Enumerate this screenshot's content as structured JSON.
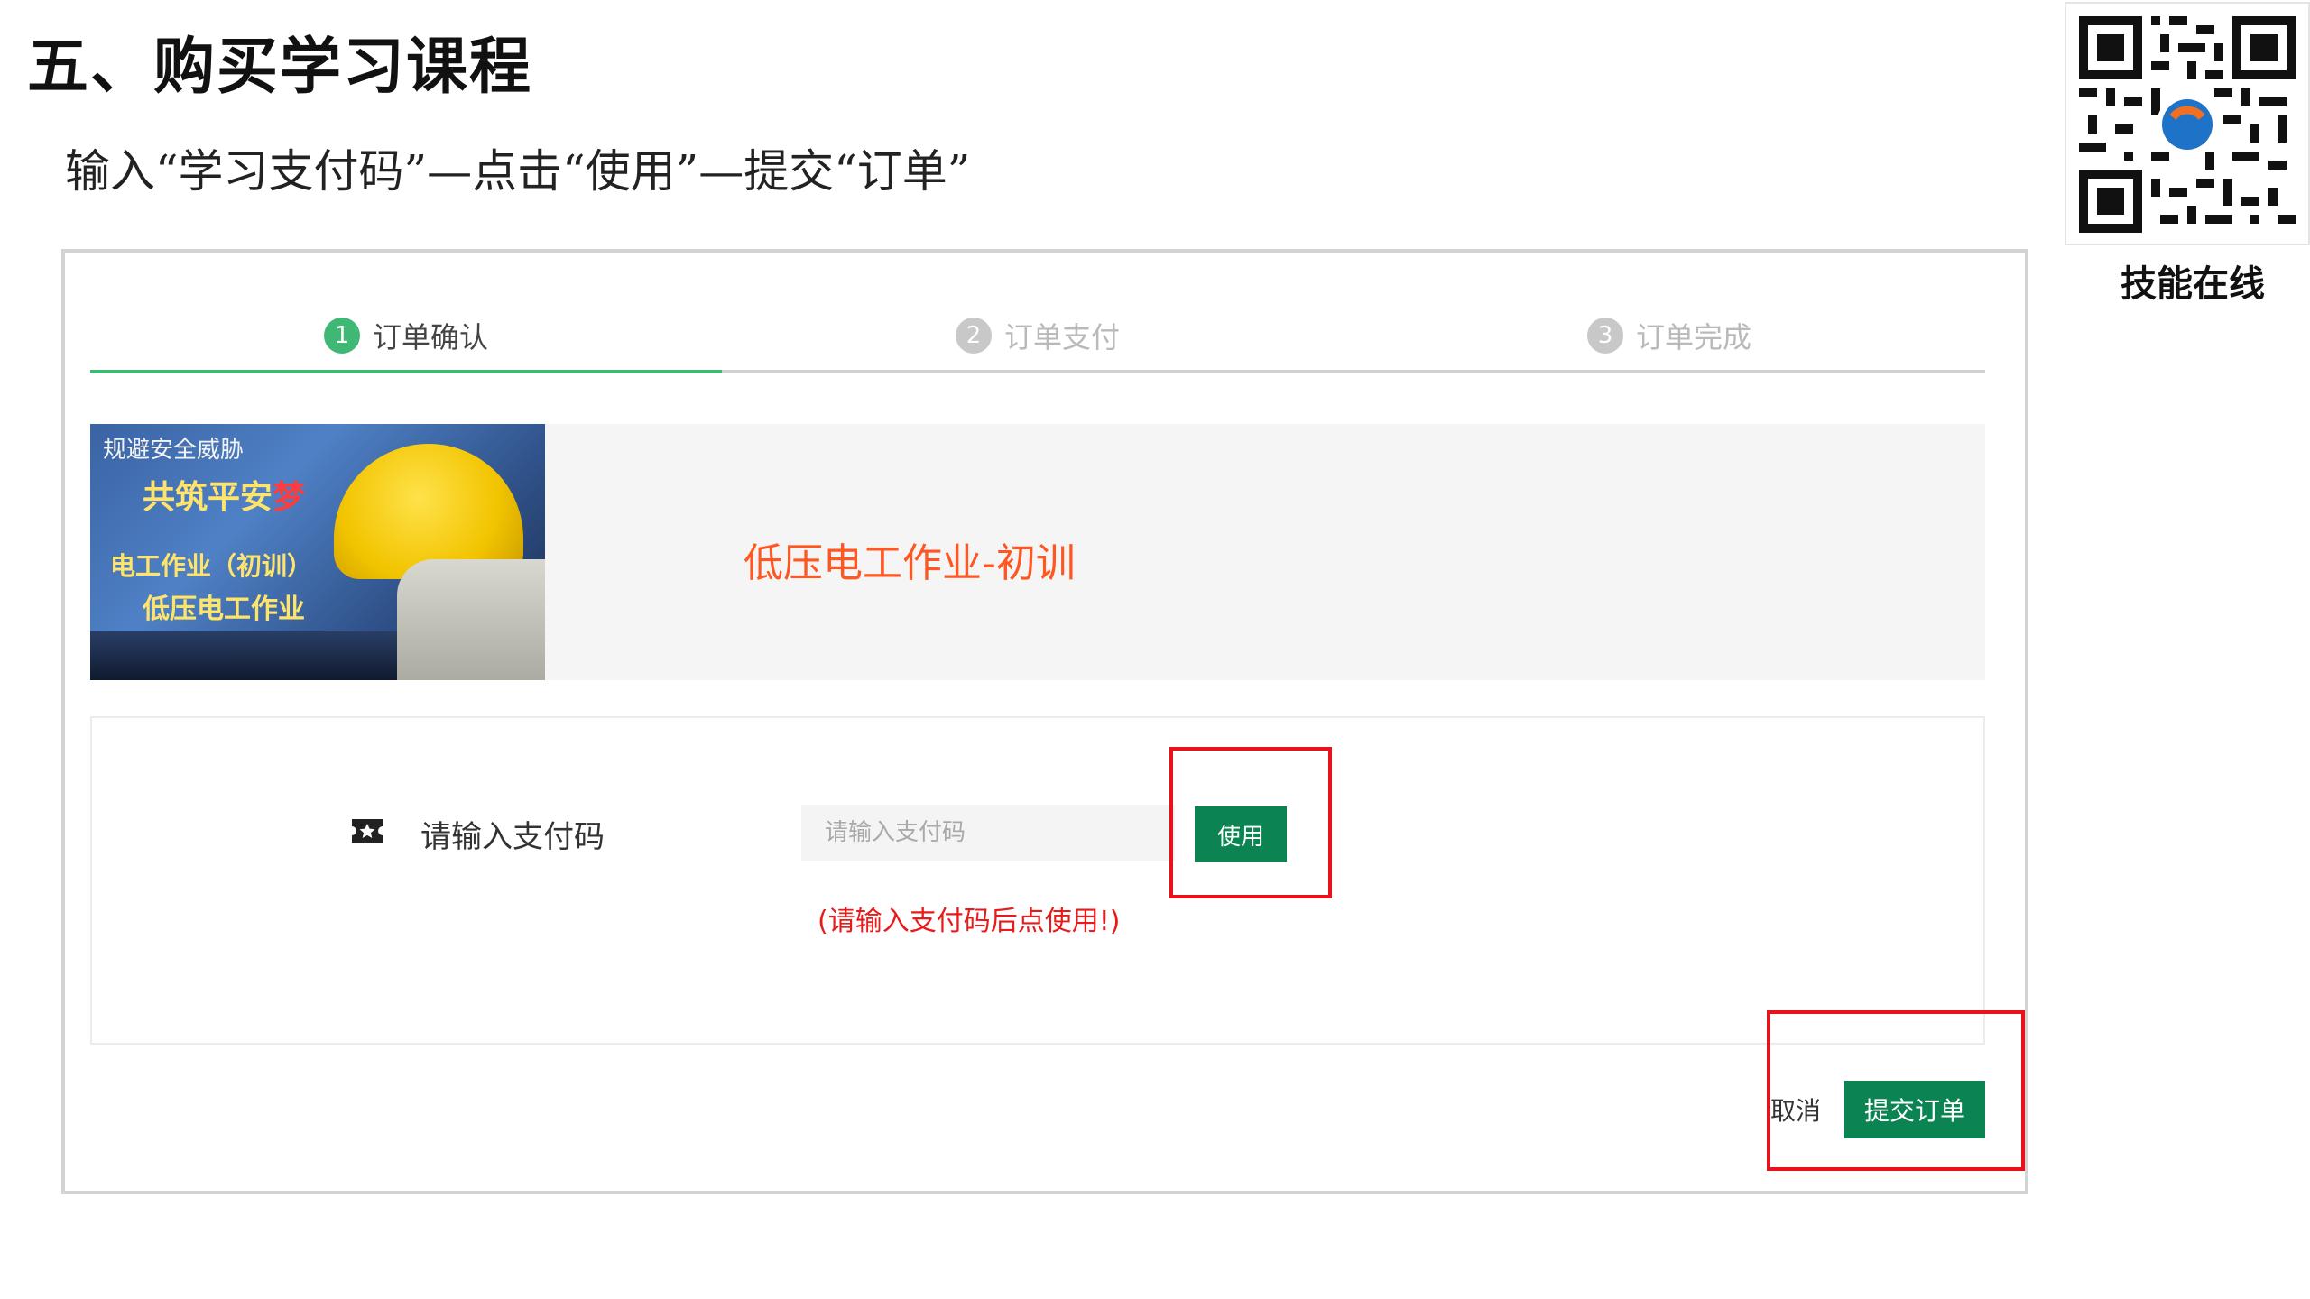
{
  "slide": {
    "title": "五、购买学习课程",
    "subtitle": "输入“学习支付码”—点击“使用”—提交“订单”",
    "qr_caption": "技能在线"
  },
  "steps": [
    {
      "num": "1",
      "label": "订单确认",
      "state": "active"
    },
    {
      "num": "2",
      "label": "订单支付",
      "state": "pending"
    },
    {
      "num": "3",
      "label": "订单完成",
      "state": "pending"
    }
  ],
  "course": {
    "image_text": {
      "line1": "规避安全威胁",
      "line2a": "共筑平安",
      "line2b": "梦",
      "line3": "电工作业（初训）",
      "line4": "低压电工作业"
    },
    "title": "低压电工作业-初训"
  },
  "payment": {
    "label": "请输入支付码",
    "input_placeholder": "请输入支付码",
    "input_value": "",
    "use_button": "使用",
    "hint": "(请输入支付码后点使用!)"
  },
  "actions": {
    "cancel": "取消",
    "submit": "提交订单"
  },
  "colors": {
    "accent_green": "#3fb876",
    "button_green": "#0b8452",
    "course_title": "#ff5722",
    "hint_red": "#e81a1a",
    "highlight_red": "#e8121a"
  }
}
